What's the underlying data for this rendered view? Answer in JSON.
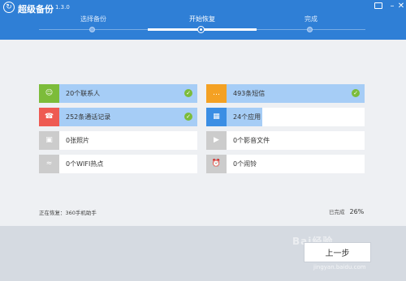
{
  "header": {
    "title": "超级备份",
    "version": "1.3.0",
    "steps": [
      {
        "label": "选择备份"
      },
      {
        "label": "开始恢复"
      },
      {
        "label": "完成"
      }
    ]
  },
  "items": [
    {
      "label": "20个联系人",
      "icon": "contact-icon",
      "color": "#7cbc3a",
      "progress": 1.0,
      "done": true
    },
    {
      "label": "493条短信",
      "icon": "sms-icon",
      "color": "#f4a123",
      "progress": 1.0,
      "done": true
    },
    {
      "label": "252条通话记录",
      "icon": "phone-icon",
      "color": "#ee5a52",
      "progress": 1.0,
      "done": true
    },
    {
      "label": "24个应用",
      "icon": "apps-icon",
      "color": "#3b8ee4",
      "progress": 0.26,
      "done": false
    },
    {
      "label": "0张照片",
      "icon": "photo-icon",
      "color": "#cccccc",
      "progress": 0,
      "done": false
    },
    {
      "label": "0个影音文件",
      "icon": "media-icon",
      "color": "#cccccc",
      "progress": 0,
      "done": false
    },
    {
      "label": "0个WIFI热点",
      "icon": "wifi-icon",
      "color": "#cccccc",
      "progress": 0,
      "done": false
    },
    {
      "label": "0个闹铃",
      "icon": "alarm-icon",
      "color": "#cccccc",
      "progress": 0,
      "done": false
    }
  ],
  "status": {
    "current": "正在恢复：360手机助手",
    "completed_label": "已完成",
    "percent": "26%"
  },
  "footer": {
    "prev_label": "上一步"
  },
  "watermark": {
    "brand": "Bai经验",
    "url": "jingyan.baidu.com"
  }
}
